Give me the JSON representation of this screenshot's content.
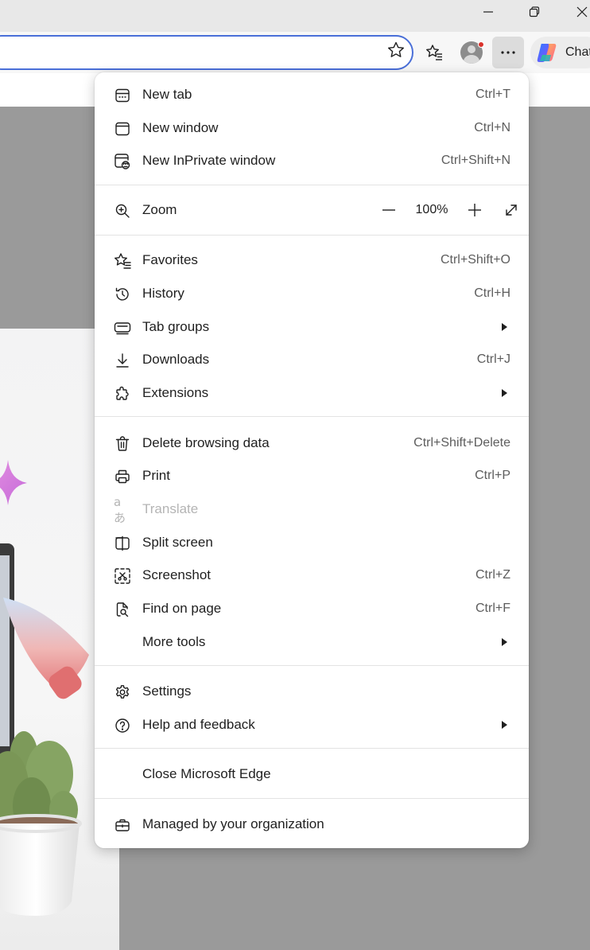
{
  "toolbar": {
    "chat_label": "Chat"
  },
  "menu": {
    "new_tab": {
      "label": "New tab",
      "shortcut": "Ctrl+T"
    },
    "new_window": {
      "label": "New window",
      "shortcut": "Ctrl+N"
    },
    "new_inprivate": {
      "label": "New InPrivate window",
      "shortcut": "Ctrl+Shift+N"
    },
    "zoom": {
      "label": "Zoom",
      "value": "100%"
    },
    "favorites": {
      "label": "Favorites",
      "shortcut": "Ctrl+Shift+O"
    },
    "history": {
      "label": "History",
      "shortcut": "Ctrl+H"
    },
    "tab_groups": {
      "label": "Tab groups"
    },
    "downloads": {
      "label": "Downloads",
      "shortcut": "Ctrl+J"
    },
    "extensions": {
      "label": "Extensions"
    },
    "delete_browsing": {
      "label": "Delete browsing data",
      "shortcut": "Ctrl+Shift+Delete"
    },
    "print": {
      "label": "Print",
      "shortcut": "Ctrl+P"
    },
    "translate": {
      "label": "Translate",
      "icon_glyph": "aあ"
    },
    "split_screen": {
      "label": "Split screen"
    },
    "screenshot": {
      "label": "Screenshot",
      "shortcut": "Ctrl+Z"
    },
    "find_on_page": {
      "label": "Find on page",
      "shortcut": "Ctrl+F"
    },
    "more_tools": {
      "label": "More tools"
    },
    "settings": {
      "label": "Settings"
    },
    "help_feedback": {
      "label": "Help and feedback"
    },
    "close_edge": {
      "label": "Close Microsoft Edge"
    },
    "managed": {
      "label": "Managed by your organization"
    }
  },
  "colors": {
    "accent": "#4a6fd8",
    "notification_dot": "#d9322b",
    "page_background": "#9a9a9a"
  }
}
